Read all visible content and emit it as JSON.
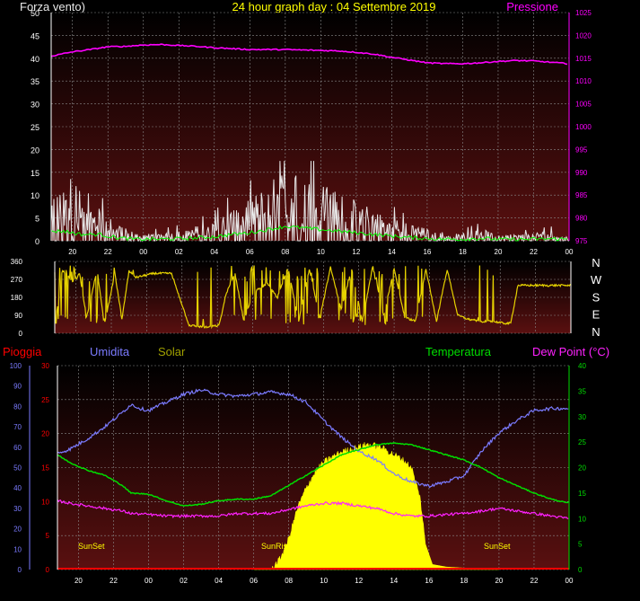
{
  "header": {
    "left": "Forza vento)",
    "center": "24 hour graph day : 04 Settembre 2019",
    "right": "Pressione"
  },
  "compass": [
    "N",
    "W",
    "S",
    "E",
    "N"
  ],
  "bottom_labels": {
    "rain": "Pioggia",
    "humidity": "Umidita",
    "solar": "Solar",
    "temperature": "Temperatura",
    "dewpoint": "Dew Point (°C)"
  },
  "sun_labels": {
    "sunset1": "SunSet",
    "sunrise": "SunRis",
    "sunset2": "SunSet"
  },
  "colors": {
    "pressure": "#ff00ff",
    "wind": "#e8e8e8",
    "wind_avg": "#00ff00",
    "direction": "#e6d200",
    "humidity": "#7b7bff",
    "temperature": "#00dd00",
    "dewpoint": "#ff22ff",
    "solar": "#ffff00",
    "rain": "#ff0000",
    "grid": "#8a8a8a",
    "bg_top": "#000000",
    "bg_bottom": "#5a1010"
  },
  "chart_data": [
    {
      "type": "line",
      "id": "wind_pressure",
      "x_ticks": [
        "20",
        "22",
        "00",
        "02",
        "04",
        "06",
        "08",
        "10",
        "12",
        "14",
        "16",
        "18",
        "20",
        "22",
        "00"
      ],
      "y_left_ticks": [
        0,
        5,
        10,
        15,
        20,
        25,
        30,
        35,
        40,
        45,
        50
      ],
      "y_right_ticks": [
        975,
        980,
        985,
        990,
        995,
        1000,
        1005,
        1010,
        1015,
        1020,
        1025
      ],
      "ylim_left": [
        0,
        50
      ],
      "ylim_right": [
        975,
        1025
      ],
      "series": [
        {
          "name": "Pressione",
          "axis": "right",
          "x": [
            18.8,
            19,
            20,
            21,
            22,
            23,
            24,
            25,
            26,
            27,
            28,
            29,
            30,
            31,
            32,
            33,
            34,
            35,
            36,
            37,
            38,
            39,
            40,
            41,
            42,
            43,
            44,
            45,
            46,
            47,
            48
          ],
          "values": [
            1015.5,
            1015.6,
            1016.4,
            1016.9,
            1017.5,
            1017.6,
            1017.9,
            1018.0,
            1017.8,
            1017.6,
            1017.3,
            1017.1,
            1016.9,
            1016.9,
            1016.9,
            1016.8,
            1016.7,
            1016.6,
            1016.3,
            1015.9,
            1015.2,
            1014.6,
            1014.0,
            1013.8,
            1013.8,
            1014.0,
            1014.3,
            1014.5,
            1014.4,
            1014.1,
            1013.8
          ]
        }
      ]
    },
    {
      "type": "line",
      "id": "wind_direction",
      "y_ticks": [
        0,
        90,
        180,
        270,
        360
      ],
      "ylim": [
        0,
        360
      ],
      "series": [
        {
          "name": "direction",
          "x": [
            18.8,
            19.2,
            19.8,
            20.2,
            20.6,
            21.2,
            21.6,
            22.2,
            22.6,
            23.0,
            23.4,
            24.4,
            25.4,
            26.4,
            27.4,
            28.1,
            28.5,
            29.0,
            29.5,
            30.0,
            30.8,
            31.4,
            32.0,
            32.6,
            33.2,
            33.8,
            34.4,
            35.0,
            35.6,
            36.2,
            36.8,
            37.4,
            38.0,
            38.6,
            39.2,
            39.8,
            40.4,
            41.0,
            41.6,
            42.2,
            43.0,
            43.6,
            44.2,
            44.6,
            45.0,
            46.0,
            47.0,
            48.0
          ],
          "values": [
            20,
            320,
            260,
            300,
            80,
            320,
            40,
            300,
            70,
            310,
            280,
            300,
            300,
            40,
            30,
            40,
            200,
            300,
            60,
            200,
            250,
            180,
            330,
            60,
            320,
            80,
            330,
            120,
            320,
            60,
            340,
            90,
            320,
            80,
            60,
            320,
            60,
            320,
            90,
            70,
            60,
            60,
            50,
            50,
            240,
            240,
            240,
            240
          ]
        }
      ]
    },
    {
      "type": "line",
      "id": "temp_hum_solar",
      "x_ticks": [
        "20",
        "22",
        "00",
        "02",
        "04",
        "06",
        "08",
        "10",
        "12",
        "14",
        "16",
        "18",
        "20",
        "22",
        "00"
      ],
      "y_rain_ticks": [
        0,
        5,
        10,
        15,
        20,
        25,
        30
      ],
      "y_humidity_ticks": [
        0,
        10,
        20,
        30,
        40,
        50,
        60,
        70,
        80,
        90,
        100
      ],
      "y_temp_ticks": [
        0,
        5,
        10,
        15,
        20,
        25,
        30,
        35,
        40
      ],
      "ylim_rain": [
        0,
        30
      ],
      "ylim_humidity": [
        0,
        100
      ],
      "ylim_temp": [
        0,
        40
      ],
      "series": [
        {
          "name": "Umidita",
          "axis": "humidity",
          "x": [
            18.8,
            19.5,
            20.5,
            21.5,
            22.5,
            23.0,
            23.5,
            24.0,
            25.0,
            26.0,
            27.0,
            28.0,
            29.0,
            30.0,
            31.0,
            32.0,
            33.0,
            34.0,
            35.0,
            36.0,
            37.0,
            38.0,
            39.0,
            40.0,
            41.0,
            42.0,
            43.0,
            44.0,
            45.0,
            46.0,
            47.0,
            48.0
          ],
          "values": [
            57,
            59,
            64,
            70,
            77,
            81,
            79,
            78,
            82,
            86,
            88,
            86,
            85,
            86,
            87,
            86,
            82,
            73,
            65,
            58,
            54,
            47,
            43,
            41,
            43,
            46,
            58,
            67,
            73,
            78,
            79,
            79
          ]
        },
        {
          "name": "Temperatura",
          "axis": "temp",
          "x": [
            18.8,
            19.5,
            20.5,
            21.5,
            22.5,
            23.0,
            24.0,
            25.0,
            26.0,
            27.0,
            28.0,
            29.0,
            30.0,
            31.0,
            32.0,
            33.0,
            34.0,
            35.0,
            36.0,
            37.0,
            38.0,
            39.0,
            40.0,
            41.0,
            42.0,
            43.0,
            44.0,
            45.0,
            46.0,
            47.0,
            48.0
          ],
          "values": [
            22.5,
            21.0,
            19.5,
            18.5,
            16.5,
            15,
            14.8,
            13.5,
            12.5,
            12.8,
            13.5,
            13.8,
            13.8,
            14.5,
            16.5,
            18.5,
            20.5,
            22.5,
            23.5,
            24.5,
            24.8,
            24.5,
            23.5,
            22.5,
            21.5,
            20.0,
            18.0,
            16.5,
            15.0,
            13.8,
            13.0
          ]
        },
        {
          "name": "Dew Point (°C)",
          "axis": "temp",
          "x": [
            18.8,
            19.5,
            20.5,
            21.5,
            22.5,
            23.0,
            24.0,
            25.0,
            26.0,
            27.0,
            28.0,
            29.0,
            30.0,
            31.0,
            32.0,
            33.0,
            34.0,
            35.0,
            36.0,
            37.0,
            38.0,
            39.0,
            40.0,
            41.0,
            42.0,
            43.0,
            44.0,
            45.0,
            46.0,
            47.0,
            48.0
          ],
          "values": [
            13.5,
            13.0,
            12.5,
            12.0,
            11.5,
            11.0,
            10.8,
            10.5,
            10.5,
            10.5,
            10.5,
            11.0,
            11.0,
            11.0,
            11.8,
            12.5,
            13.0,
            13.0,
            12.5,
            12.0,
            11.0,
            10.5,
            10.5,
            10.8,
            11.0,
            11.5,
            12.0,
            11.5,
            11.0,
            10.5,
            10.0
          ]
        },
        {
          "name": "Solar",
          "axis": "temp_fill",
          "x": [
            30.0,
            31.0,
            31.5,
            32.0,
            32.5,
            33.0,
            33.5,
            34.0,
            34.5,
            35.0,
            35.5,
            36.0,
            36.5,
            37.0,
            37.5,
            38.0,
            38.5,
            39.0,
            39.5,
            39.8,
            40.0,
            40.2,
            41.0,
            42.0,
            43.0,
            44.0
          ],
          "values": [
            0,
            0,
            2,
            6,
            12,
            16,
            19,
            21,
            22,
            23,
            23.5,
            24,
            24.5,
            24.2,
            23.5,
            22.5,
            21.5,
            20,
            14,
            5,
            3,
            1,
            0.5,
            0.3,
            0,
            0
          ]
        },
        {
          "name": "Pioggia",
          "axis": "rain",
          "x": [
            18.8,
            48.0
          ],
          "values": [
            0,
            0
          ]
        }
      ]
    }
  ]
}
